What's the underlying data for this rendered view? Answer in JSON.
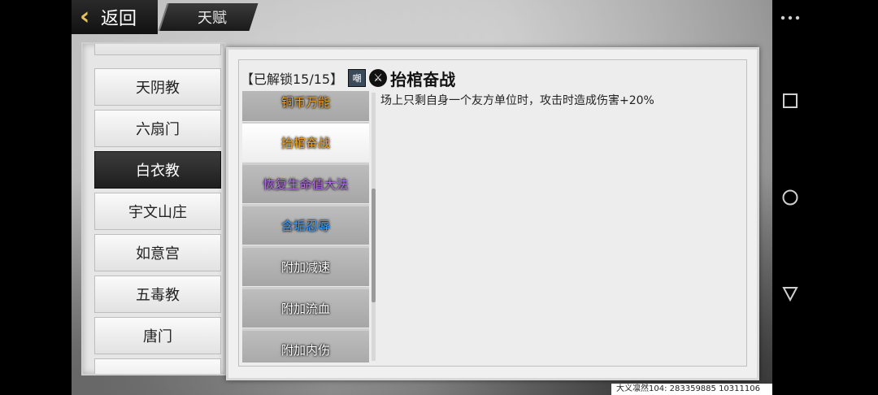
{
  "topbar": {
    "back_label": "返回",
    "title": "天赋"
  },
  "sects": [
    {
      "label": "天阴教",
      "active": false
    },
    {
      "label": "六扇门",
      "active": false
    },
    {
      "label": "白衣教",
      "active": true
    },
    {
      "label": "宇文山庄",
      "active": false
    },
    {
      "label": "如意宫",
      "active": false
    },
    {
      "label": "五毒教",
      "active": false
    },
    {
      "label": "唐门",
      "active": false
    }
  ],
  "detail": {
    "unlock_status": "【已解锁15/15】",
    "badge": "嘲",
    "skill_name": "抬棺奋战",
    "description": "场上只剩自身一个友方单位时，攻击时造成伤害+20%"
  },
  "talents": [
    {
      "label": "铜币万能",
      "color": "#f0a020",
      "active": false
    },
    {
      "label": "抬棺奋战",
      "color": "#f0a020",
      "active": true
    },
    {
      "label": "恢复生命值大法",
      "color": "#b070e0",
      "active": false
    },
    {
      "label": "含垢忍辱",
      "color": "#3fa0ff",
      "active": false
    },
    {
      "label": "附加减速",
      "color": "#ffffff",
      "active": false
    },
    {
      "label": "附加流血",
      "color": "#ffffff",
      "active": false
    },
    {
      "label": "附加内伤",
      "color": "#ffffff",
      "active": false
    }
  ],
  "footer": {
    "player_info": "大义凛然104: 283359885  10311106"
  }
}
